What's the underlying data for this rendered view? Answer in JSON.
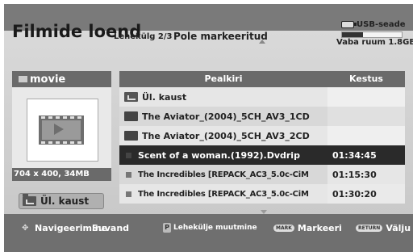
{
  "header": {
    "title": "Filmide loend",
    "page_info": "Lehekülg 2/3",
    "mark_status": "Pole markeeritud",
    "usb_label": "USB-seade",
    "free_space": "Vaba ruum 1.8GB",
    "usb_used_fraction": 0.35
  },
  "left_panel": {
    "folder_label": "movie",
    "preview_info": "704 x 400, 34MB",
    "parent_button_label": "Ül. kaust"
  },
  "table": {
    "headers": {
      "title": "Pealkiri",
      "duration": "Kestus"
    },
    "rows": [
      {
        "type": "parent",
        "title": "Ül. kaust",
        "duration": ""
      },
      {
        "type": "folder",
        "title": "The Aviator_(2004)_5CH_AV3_1CD",
        "duration": ""
      },
      {
        "type": "folder",
        "title": "The Aviator_(2004)_5CH_AV3_2CD",
        "duration": ""
      },
      {
        "type": "file",
        "title": "Scent of a woman.(1992).Dvdrip",
        "duration": "01:34:45",
        "selected": true
      },
      {
        "type": "file",
        "title": "The Incredibles [REPACK_AC3_5.0c-CiM",
        "duration": "01:15:30"
      },
      {
        "type": "file",
        "title": "The Incredibles [REPACK_AC3_5.0c-CiM",
        "duration": "01:30:20"
      }
    ]
  },
  "footer": {
    "navigate_label": "Navigeerimine",
    "option_label": "Suvand",
    "page_change_label": "Lehekülje muutmine",
    "mark_key_label": "MARK",
    "mark_label": "Markeeri",
    "return_key_label": "RETURN",
    "exit_label": "Välju"
  },
  "icons": {
    "usb": "usb-icon",
    "folder": "folder-icon",
    "parent_folder": "parent-folder-icon",
    "video_file": "video-file-icon",
    "navigate": "navigate-arrows-icon",
    "page_button": "p-button-icon"
  },
  "colors": {
    "selected_row": "#2a2a2a",
    "header_bg": "#6a6a6a",
    "panel_bg": "#d9d9d9"
  }
}
